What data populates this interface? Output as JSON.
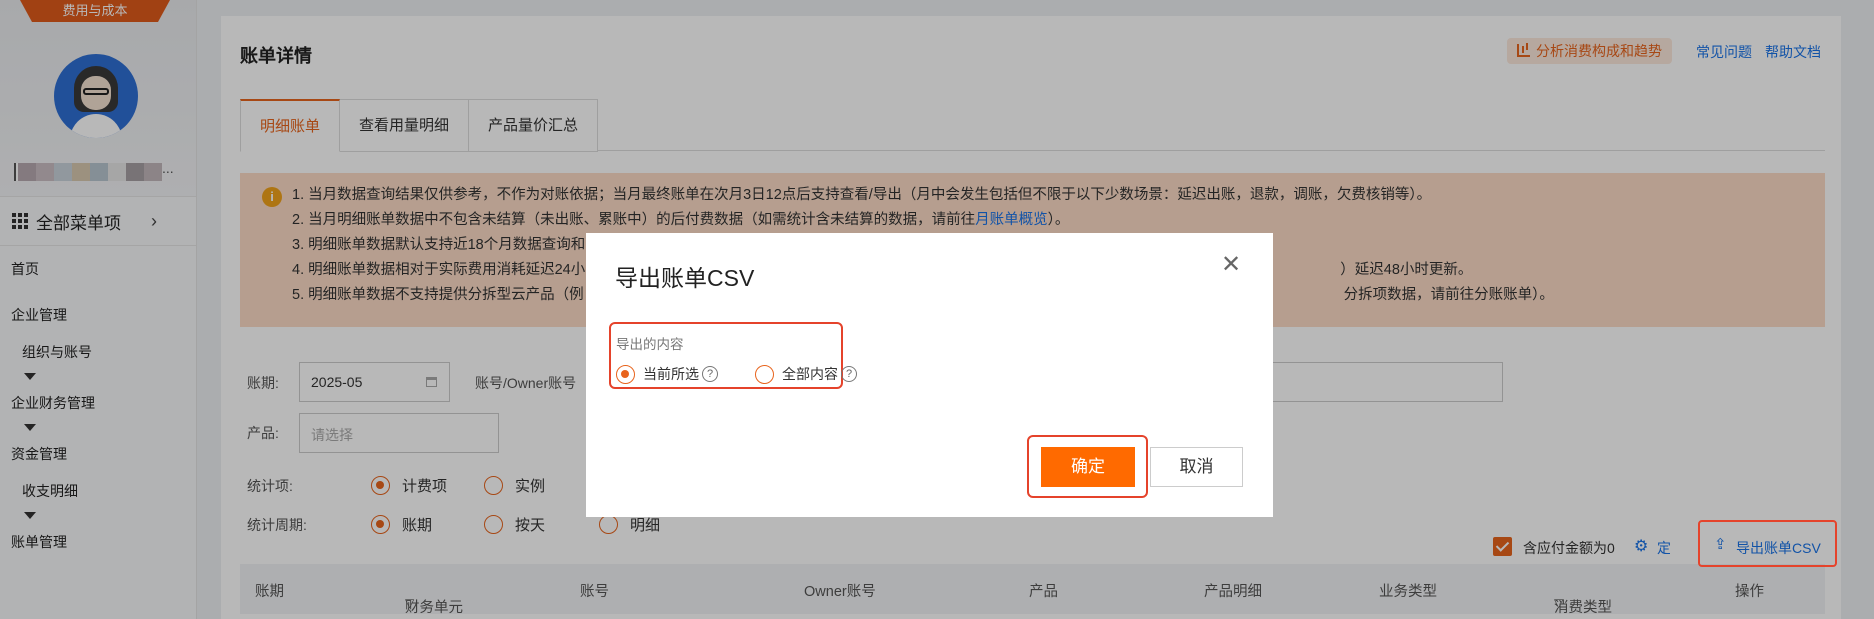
{
  "sidebar": {
    "banner": "费用与成本",
    "user_suffix": "...",
    "all_menu": "全部菜单项",
    "items": [
      {
        "label": "首页"
      },
      {
        "label": "企业管理"
      },
      {
        "label": "组织与账号"
      },
      {
        "label": "企业财务管理"
      },
      {
        "label": "资金管理"
      },
      {
        "label": "收支明细"
      },
      {
        "label": "账单管理"
      }
    ]
  },
  "header": {
    "title": "账单详情",
    "analyze": "分析消费构成和趋势",
    "faq": "常见问题",
    "help": "帮助文档"
  },
  "tabs": [
    {
      "label": "明细账单"
    },
    {
      "label": "查看用量明细"
    },
    {
      "label": "产品量价汇总"
    }
  ],
  "notice": {
    "icon": "i",
    "line1": "1. 当月数据查询结果仅供参考，不作为对账依据；当月最终账单在次月3日12点后支持查看/导出（月中会发生包括但不限于以下少数场景：延迟出账，退款，调账，欠费核销等）。",
    "line2_a": "2. 当月明细账单数据中不包含未结算（未出账、累账中）的后付费数据（如需统计含未结算的数据，请前往",
    "line2_link": "月账单概览",
    "line2_b": "）。",
    "line3": "3. 明细账单数据默认支持近18个月数据查询和",
    "line4_a": "4. 明细账单数据相对于实际费用消耗延迟24小",
    "line4_b": "）延迟48小时更新。",
    "line5_a": "5. 明细账单数据不支持提供分拆型云产品（例",
    "line5_b": "分拆项数据，请前往分账账单）。"
  },
  "filters": {
    "period_label": "账期:",
    "period_value": "2025-05",
    "account_label": "账号/Owner账号",
    "product_label": "产品:",
    "product_placeholder": "请选择",
    "stat_item_label": "统计项:",
    "stat_item_opts": [
      "计费项",
      "实例"
    ],
    "stat_period_label": "统计周期:",
    "stat_period_opts": [
      "账期",
      "按天",
      "明细"
    ]
  },
  "toolbar": {
    "zero_label": "含应付金额为0",
    "custom_cols": "定制列",
    "export": "导出账单CSV"
  },
  "table": {
    "columns": [
      "账期",
      "财务单元",
      "账号",
      "Owner账号",
      "产品",
      "产品明细",
      "业务类型",
      "消费类型",
      "操作"
    ]
  },
  "modal": {
    "title": "导出账单CSV",
    "content_label": "导出的内容",
    "options": [
      "当前所选",
      "全部内容"
    ],
    "ok": "确定",
    "cancel": "取消"
  },
  "colors": {
    "accent": "#e8641d",
    "primary_button": "#ff6a00",
    "highlight_box": "#e5432b",
    "link": "#1a73e8"
  }
}
